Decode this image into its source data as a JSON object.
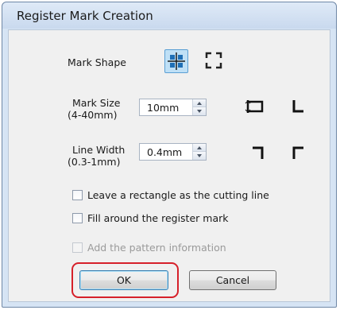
{
  "window": {
    "title": "Register Mark Creation"
  },
  "mark_shape": {
    "label": "Mark Shape",
    "options": [
      {
        "icon": "crosshair-corners-icon",
        "selected": true
      },
      {
        "icon": "corner-brackets-icon",
        "selected": false
      }
    ]
  },
  "mark_size": {
    "label_line1": "Mark Size",
    "label_line2": "(4-40mm)",
    "value": "10mm"
  },
  "line_width": {
    "label_line1": "Line Width",
    "label_line2": "(0.3-1mm)",
    "value": "0.4mm"
  },
  "checkboxes": [
    {
      "label": "Leave a rectangle as the cutting line",
      "checked": false,
      "enabled": true
    },
    {
      "label": "Fill around the register mark",
      "checked": false,
      "enabled": true
    },
    {
      "label": "Add the pattern information",
      "checked": false,
      "enabled": false
    }
  ],
  "buttons": {
    "ok": "OK",
    "cancel": "Cancel"
  },
  "preview_icons": [
    "size-dimension-icon",
    "bottom-left-corner-icon",
    "top-right-corner-icon",
    "top-left-corner-icon"
  ],
  "colors": {
    "highlight": "#d6202a",
    "selected_shape": "#bfe0f6"
  }
}
